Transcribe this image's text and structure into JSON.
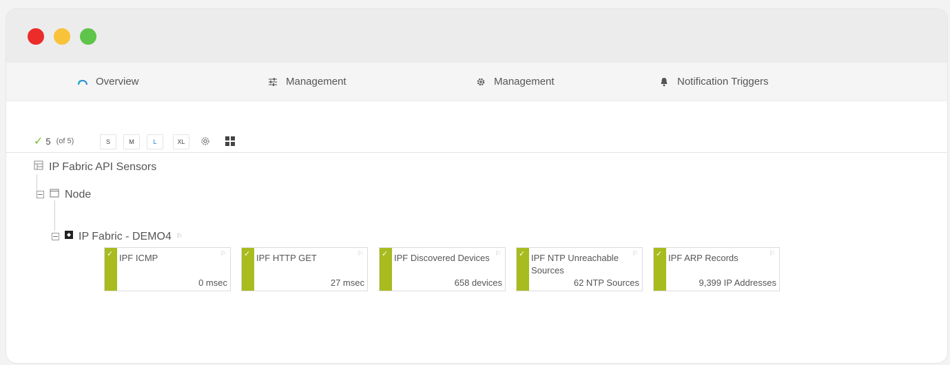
{
  "window": {
    "controls": [
      "close",
      "minimize",
      "maximize"
    ]
  },
  "tabs": [
    {
      "label": "Overview",
      "icon": "gauge-icon"
    },
    {
      "label": "Management",
      "icon": "sliders-icon"
    },
    {
      "label": "Management",
      "icon": "gear-icon"
    },
    {
      "label": "Notification Triggers",
      "icon": "bell-icon"
    }
  ],
  "toolbar": {
    "count": "5",
    "of": "(of 5)",
    "sizes": [
      "S",
      "M",
      "L",
      "XL"
    ],
    "active_size": "L"
  },
  "tree": {
    "root": "IP Fabric API Sensors",
    "node": "Node",
    "device": "IP Fabric - DEMO4"
  },
  "sensors": [
    {
      "name": "IPF ICMP",
      "value": "0 msec"
    },
    {
      "name": "IPF HTTP GET",
      "value": "27 msec"
    },
    {
      "name": "IPF Discovered Devices",
      "value": "658 devices"
    },
    {
      "name": "IPF NTP Unreachable Sources",
      "value": "62 NTP Sources"
    },
    {
      "name": "IPF ARP Records",
      "value": "9,399 IP Addresses"
    }
  ],
  "colors": {
    "status_up": "#a8bb1f",
    "accent": "#1c7bd6"
  }
}
